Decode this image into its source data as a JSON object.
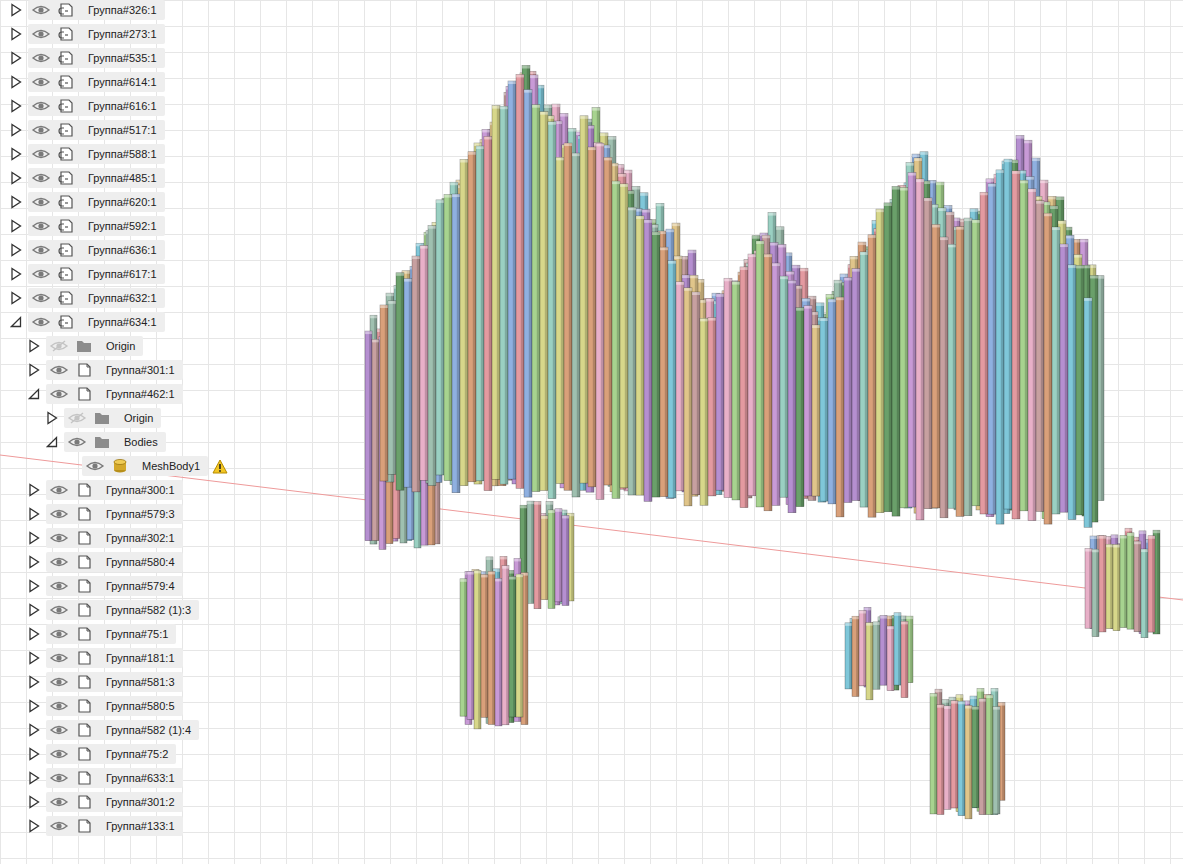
{
  "browser": {
    "items": [
      {
        "label": "Группа#326:1",
        "level": 0,
        "kind": "linked",
        "expandable": true,
        "expanded": false,
        "visible": true,
        "warning": false
      },
      {
        "label": "Группа#273:1",
        "level": 0,
        "kind": "linked",
        "expandable": true,
        "expanded": false,
        "visible": true,
        "warning": false
      },
      {
        "label": "Группа#535:1",
        "level": 0,
        "kind": "linked",
        "expandable": true,
        "expanded": false,
        "visible": true,
        "warning": false
      },
      {
        "label": "Группа#614:1",
        "level": 0,
        "kind": "linked",
        "expandable": true,
        "expanded": false,
        "visible": true,
        "warning": false
      },
      {
        "label": "Группа#616:1",
        "level": 0,
        "kind": "linked",
        "expandable": true,
        "expanded": false,
        "visible": true,
        "warning": false
      },
      {
        "label": "Группа#517:1",
        "level": 0,
        "kind": "linked",
        "expandable": true,
        "expanded": false,
        "visible": true,
        "warning": false
      },
      {
        "label": "Группа#588:1",
        "level": 0,
        "kind": "linked",
        "expandable": true,
        "expanded": false,
        "visible": true,
        "warning": false
      },
      {
        "label": "Группа#485:1",
        "level": 0,
        "kind": "linked",
        "expandable": true,
        "expanded": false,
        "visible": true,
        "warning": false
      },
      {
        "label": "Группа#620:1",
        "level": 0,
        "kind": "linked",
        "expandable": true,
        "expanded": false,
        "visible": true,
        "warning": false
      },
      {
        "label": "Группа#592:1",
        "level": 0,
        "kind": "linked",
        "expandable": true,
        "expanded": false,
        "visible": true,
        "warning": false
      },
      {
        "label": "Группа#636:1",
        "level": 0,
        "kind": "linked",
        "expandable": true,
        "expanded": false,
        "visible": true,
        "warning": false
      },
      {
        "label": "Группа#617:1",
        "level": 0,
        "kind": "linked",
        "expandable": true,
        "expanded": false,
        "visible": true,
        "warning": false
      },
      {
        "label": "Группа#632:1",
        "level": 0,
        "kind": "linked",
        "expandable": true,
        "expanded": false,
        "visible": true,
        "warning": false
      },
      {
        "label": "Группа#634:1",
        "level": 0,
        "kind": "linked",
        "expandable": true,
        "expanded": true,
        "visible": true,
        "warning": false
      },
      {
        "label": "Origin",
        "level": 1,
        "kind": "folder",
        "expandable": true,
        "expanded": false,
        "visible": false,
        "warning": false
      },
      {
        "label": "Группа#301:1",
        "level": 1,
        "kind": "component",
        "expandable": true,
        "expanded": false,
        "visible": true,
        "warning": false
      },
      {
        "label": "Группа#462:1",
        "level": 1,
        "kind": "component",
        "expandable": true,
        "expanded": true,
        "visible": true,
        "warning": false
      },
      {
        "label": "Origin",
        "level": 2,
        "kind": "folder",
        "expandable": true,
        "expanded": false,
        "visible": false,
        "warning": false
      },
      {
        "label": "Bodies",
        "level": 2,
        "kind": "folder",
        "expandable": true,
        "expanded": true,
        "visible": true,
        "warning": false
      },
      {
        "label": "MeshBody1",
        "level": 3,
        "kind": "mesh",
        "expandable": false,
        "expanded": false,
        "visible": true,
        "warning": true
      },
      {
        "label": "Группа#300:1",
        "level": 1,
        "kind": "component",
        "expandable": true,
        "expanded": false,
        "visible": true,
        "warning": false
      },
      {
        "label": "Группа#579:3",
        "level": 1,
        "kind": "component",
        "expandable": true,
        "expanded": false,
        "visible": true,
        "warning": false
      },
      {
        "label": "Группа#302:1",
        "level": 1,
        "kind": "component",
        "expandable": true,
        "expanded": false,
        "visible": true,
        "warning": false
      },
      {
        "label": "Группа#580:4",
        "level": 1,
        "kind": "component",
        "expandable": true,
        "expanded": false,
        "visible": true,
        "warning": false
      },
      {
        "label": "Группа#579:4",
        "level": 1,
        "kind": "component",
        "expandable": true,
        "expanded": false,
        "visible": true,
        "warning": false
      },
      {
        "label": "Группа#582 (1):3",
        "level": 1,
        "kind": "component",
        "expandable": true,
        "expanded": false,
        "visible": true,
        "warning": false
      },
      {
        "label": "Группа#75:1",
        "level": 1,
        "kind": "component",
        "expandable": true,
        "expanded": false,
        "visible": true,
        "warning": false
      },
      {
        "label": "Группа#181:1",
        "level": 1,
        "kind": "component",
        "expandable": true,
        "expanded": false,
        "visible": true,
        "warning": false
      },
      {
        "label": "Группа#581:3",
        "level": 1,
        "kind": "component",
        "expandable": true,
        "expanded": false,
        "visible": true,
        "warning": false
      },
      {
        "label": "Группа#580:5",
        "level": 1,
        "kind": "component",
        "expandable": true,
        "expanded": false,
        "visible": true,
        "warning": false
      },
      {
        "label": "Группа#582 (1):4",
        "level": 1,
        "kind": "component",
        "expandable": true,
        "expanded": false,
        "visible": true,
        "warning": false
      },
      {
        "label": "Группа#75:2",
        "level": 1,
        "kind": "component",
        "expandable": true,
        "expanded": false,
        "visible": true,
        "warning": false
      },
      {
        "label": "Группа#633:1",
        "level": 1,
        "kind": "component",
        "expandable": true,
        "expanded": false,
        "visible": true,
        "warning": false
      },
      {
        "label": "Группа#301:2",
        "level": 1,
        "kind": "component",
        "expandable": true,
        "expanded": false,
        "visible": true,
        "warning": false
      },
      {
        "label": "Группа#133:1",
        "level": 1,
        "kind": "component",
        "expandable": true,
        "expanded": false,
        "visible": true,
        "warning": false
      }
    ]
  }
}
